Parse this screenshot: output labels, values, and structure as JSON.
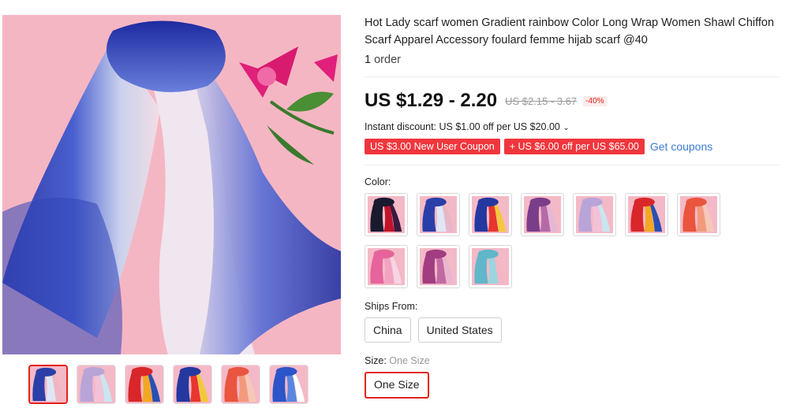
{
  "product": {
    "title": "Hot Lady scarf women Gradient rainbow Color Long Wrap Women Shawl Chiffon Scarf Apparel Accessory foulard femme hijab scarf @40",
    "orders_count": "1",
    "orders_label": "order"
  },
  "price": {
    "current": "US $1.29 - 2.20",
    "original": "US $2.15 - 3.67",
    "discount": "-40%"
  },
  "promo": {
    "instant_discount": "Instant discount: US $1.00 off per US $20.00",
    "coupons": [
      "US $3.00 New User Coupon",
      "+ US $6.00 off per US $65.00"
    ],
    "get_coupons": "Get coupons"
  },
  "color": {
    "label": "Color:",
    "swatches": [
      {
        "name": "black-red",
        "c1": "#1a1a2e",
        "c2": "#c0142a",
        "c3": "#3a1a40"
      },
      {
        "name": "blue-white",
        "c1": "#2b3fa8",
        "c2": "#dfe6f5",
        "c3": "#e7b7c9"
      },
      {
        "name": "rainbow-blue",
        "c1": "#2438a0",
        "c2": "#e7352f",
        "c3": "#f3c83b"
      },
      {
        "name": "purple",
        "c1": "#7a3d8a",
        "c2": "#b56aa8",
        "c3": "#e6b7d6"
      },
      {
        "name": "pastel",
        "c1": "#b9a4d8",
        "c2": "#f3c2d9",
        "c3": "#c8e6f0"
      },
      {
        "name": "rainbow",
        "c1": "#d9262a",
        "c2": "#f2a823",
        "c3": "#2a4fb2"
      },
      {
        "name": "coral",
        "c1": "#e9553e",
        "c2": "#f39a7d",
        "c3": "#f6c8b8"
      },
      {
        "name": "pink",
        "c1": "#e7639b",
        "c2": "#f2a3c2",
        "c3": "#f8d4e2"
      },
      {
        "name": "magenta",
        "c1": "#a23d82",
        "c2": "#c26aa2",
        "c3": "#e9b6d0"
      },
      {
        "name": "aqua-pink",
        "c1": "#5fb7c9",
        "c2": "#9cd5df",
        "c3": "#f3b6c4"
      }
    ]
  },
  "ships_from": {
    "label": "Ships From:",
    "options": [
      "China",
      "United States"
    ]
  },
  "size": {
    "label": "Size:",
    "selected_value": "One Size",
    "options": [
      "One Size"
    ]
  },
  "gallery": {
    "thumbnails": [
      {
        "c1": "#2b3fa8",
        "c2": "#dfe6f5",
        "c3": "#f0b6c4"
      },
      {
        "c1": "#b9a4d8",
        "c2": "#f3c2d9",
        "c3": "#c8e6f0"
      },
      {
        "c1": "#d9262a",
        "c2": "#f2a823",
        "c3": "#2a4fb2"
      },
      {
        "c1": "#2438a0",
        "c2": "#e7352f",
        "c3": "#f3c83b"
      },
      {
        "c1": "#e9553e",
        "c2": "#f39a7d",
        "c3": "#f6c8b8"
      },
      {
        "c1": "#2b55c8",
        "c2": "#5b86e0",
        "c3": "#ffffff"
      }
    ]
  },
  "colors": {
    "accent_red": "#e2231a",
    "coupon_red": "#f0363d",
    "link_blue": "#3b7bd1"
  }
}
